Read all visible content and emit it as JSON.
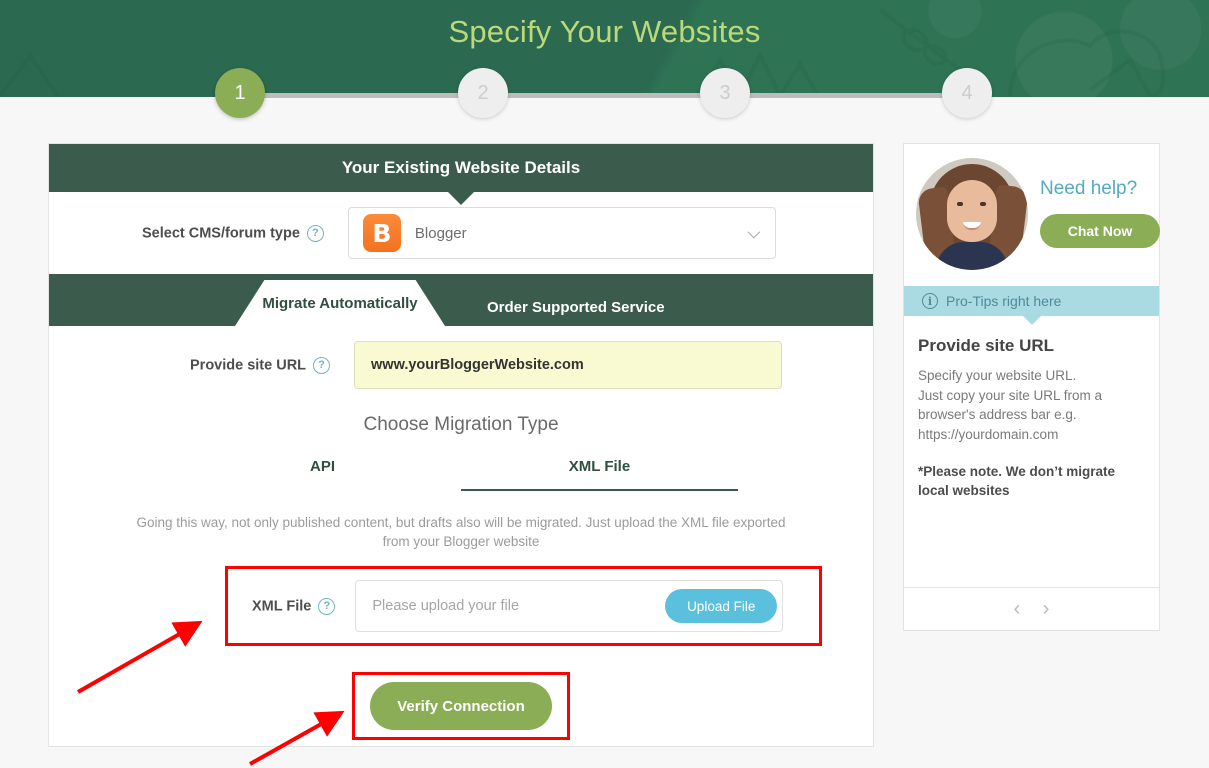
{
  "header": {
    "title": "Specify Your Websites",
    "steps": [
      {
        "label": "1",
        "state": "active"
      },
      {
        "label": "2",
        "state": "inactive"
      },
      {
        "label": "3",
        "state": "inactive"
      },
      {
        "label": "4",
        "state": "inactive"
      }
    ]
  },
  "card": {
    "title": "Your Existing Website Details",
    "cms": {
      "label": "Select CMS/forum type",
      "help": "?",
      "value": "Blogger",
      "icon_letter": "B",
      "chevron": "chevron-down"
    },
    "tabs": {
      "active": "Migrate Automatically",
      "inactive": "Order Supported Service"
    },
    "site_url": {
      "label": "Provide site URL",
      "help": "?",
      "value": "www.yourBloggerWebsite.com"
    },
    "migration": {
      "title": "Choose Migration Type",
      "options": [
        {
          "label": "API",
          "selected": false
        },
        {
          "label": "XML File",
          "selected": true
        }
      ],
      "description": "Going this way, not only published content, but drafts also will be migrated. Just upload the XML file exported from your Blogger website"
    },
    "xml_file": {
      "label": "XML File",
      "help": "?",
      "placeholder": "Please upload your file",
      "upload_label": "Upload File"
    },
    "verify_label": "Verify Connection"
  },
  "sidebar": {
    "need_help": "Need help?",
    "chat_label": "Chat Now",
    "protips_label": "Pro-Tips right here",
    "protips_icon": "i",
    "tip_title": "Provide site URL",
    "tip_body": "Specify your website URL.\nJust copy your site URL from a\nbrowser's address bar e.g.\nhttps://yourdomain.com",
    "tip_note": "*Please note. We don’t migrate local websites",
    "prev": "‹",
    "next": "›"
  },
  "colors": {
    "header_green": "#2b6a51",
    "title_green": "#bcd97a",
    "dark_green": "#3b5c4c",
    "accent_green": "#8aad56",
    "teal": "#54aac2",
    "protips_bg": "#aadbe2",
    "blogger_orange": "#f4711f",
    "upload_blue": "#5bc0de",
    "highlight_red": "#ff0000",
    "url_field_yellow": "#fafad2"
  }
}
